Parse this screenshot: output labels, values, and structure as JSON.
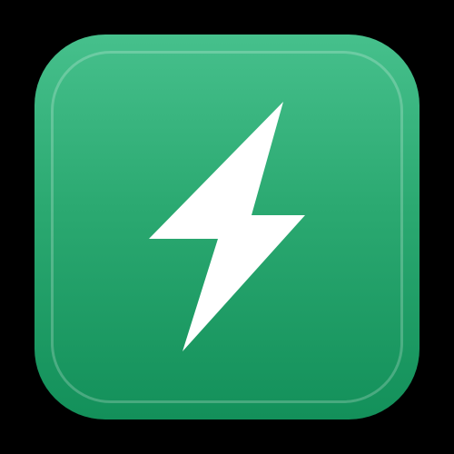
{
  "app_icon": {
    "glyph": "lightning-bolt-icon",
    "colors": {
      "background": "#000000",
      "tile_top": "#46c08c",
      "tile_mid": "#2ba971",
      "tile_bottom": "#13905a",
      "inner_border": "#ffffff",
      "glyph": "#ffffff"
    }
  }
}
